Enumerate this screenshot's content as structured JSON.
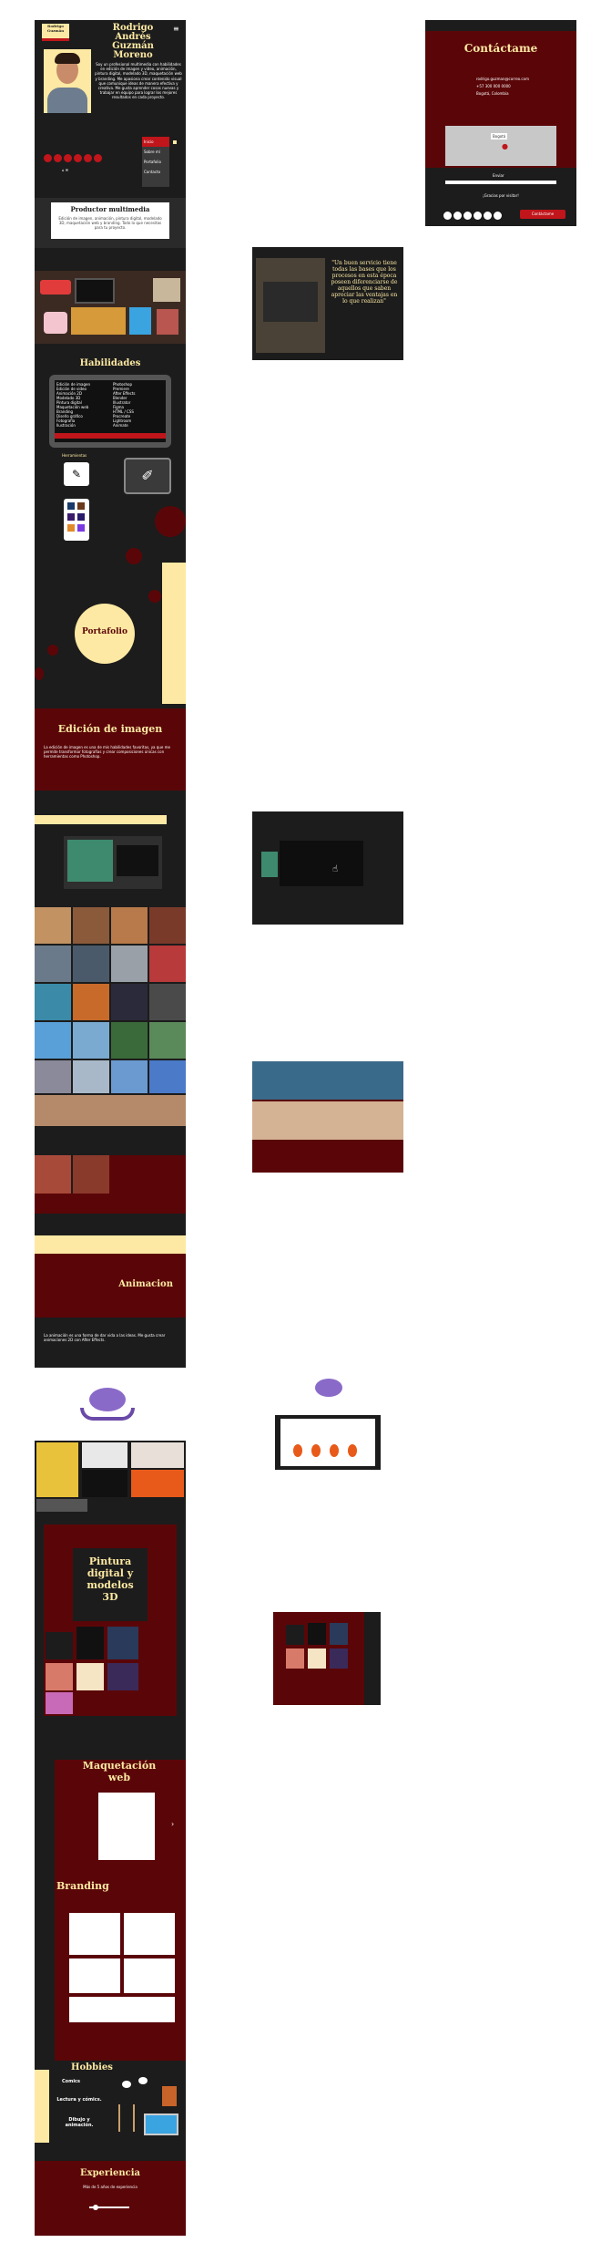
{
  "profile": {
    "logo_line1": "Rodrigo",
    "logo_line2": "Guzmán",
    "name_line1": "Rodrigo",
    "name_line2": "Andrés",
    "name_line3": "Guzmán",
    "name_line4": "Moreno",
    "bio": "Soy un profesional multimedia con habilidades en edición de imagen y video, animación, pintura digital, modelado 3D, maquetación web y branding. Me apasiona crear contenido visual que comunique ideas de manera efectiva y creativa. Me gusta aprender cosas nuevas y trabajar en equipo para lograr los mejores resultados en cada proyecto."
  },
  "menu": {
    "items": [
      "Inicio",
      "Sobre mí",
      "Portafolio",
      "Contacto"
    ]
  },
  "productor": {
    "title": "Productor multimedia",
    "text": "Edición de imagen, animación, pintura digital, modelado 3D, maquetación web y branding. Todo lo que necesitas para tu proyecto."
  },
  "quote": {
    "text": "\"Un buen servicio tiene todas las bases que los procesos en esta época poseen diferenciarse de aquellos que saben apreciar las ventajas en lo que realizan\""
  },
  "habilidades": {
    "title": "Habilidades",
    "left": [
      "Edición de imagen",
      "Edición de video",
      "Animación 2D",
      "Modelado 3D",
      "Pintura digital",
      "Maquetación web",
      "Branding",
      "Diseño gráfico",
      "Fotografía",
      "Ilustración"
    ],
    "right": [
      "Photoshop",
      "Premiere",
      "After Effects",
      "Blender",
      "Illustrator",
      "Figma",
      "HTML / CSS",
      "Procreate",
      "Lightroom",
      "Animate"
    ],
    "tools_label": "Herramientas"
  },
  "portafolio": {
    "title": "Portafolio"
  },
  "edicion": {
    "title": "Edición de imagen",
    "text": "La edición de imagen es una de mis habilidades favoritas, ya que me permite transformar fotografías y crear composiciones únicas con herramientas como Photoshop."
  },
  "animacion": {
    "title": "Animacion",
    "text": "La animación es una forma de dar vida a las ideas. Me gusta crear animaciones 2D con After Effects."
  },
  "pintura": {
    "title_line1": "Pintura",
    "title_line2": "digital y",
    "title_line3": "modelos",
    "title_line4": "3D"
  },
  "maquetacion": {
    "title_line1": "Maquetación",
    "title_line2": "web"
  },
  "branding": {
    "title": "Branding"
  },
  "hobbies": {
    "title": "Hobbies",
    "item1": "Comics",
    "item2": "Lectura y cómics.",
    "item3": "Dibujo y animación."
  },
  "experiencia": {
    "title": "Experiencia",
    "text": "Más de 5 años de experiencia"
  },
  "contact": {
    "title": "Contáctame",
    "email": "rodrigo.guzman@correo.com",
    "phone": "+57 300 000 0000",
    "city": "Bogotá, Colombia",
    "button": "Enviar",
    "footer_text": "¡Gracias por visitar!",
    "chat_button": "Contáctame",
    "map_label": "Bogotá"
  },
  "colors": {
    "maroon": "#5a0608",
    "dark": "#1c1c1c",
    "cream": "#fde9a3"
  }
}
